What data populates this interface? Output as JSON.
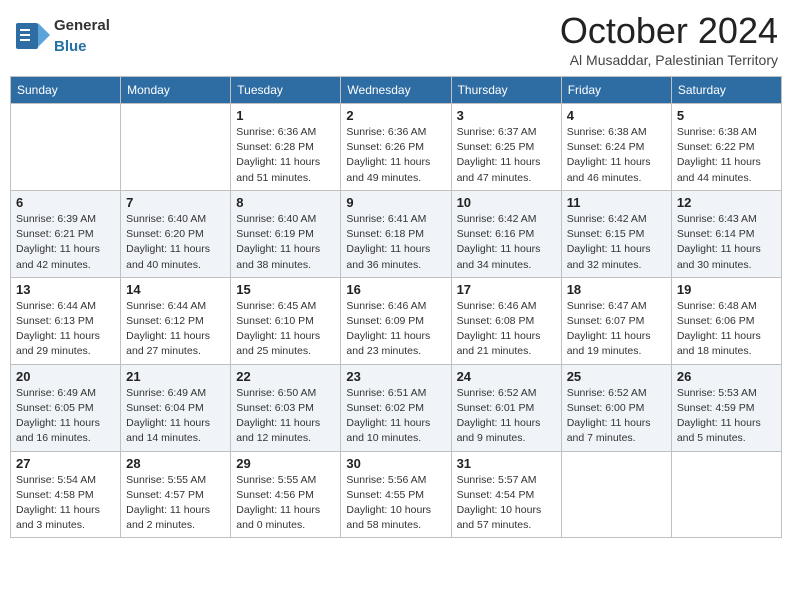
{
  "logo": {
    "text_general": "General",
    "text_blue": "Blue"
  },
  "header": {
    "month_title": "October 2024",
    "subtitle": "Al Musaddar, Palestinian Territory"
  },
  "weekdays": [
    "Sunday",
    "Monday",
    "Tuesday",
    "Wednesday",
    "Thursday",
    "Friday",
    "Saturday"
  ],
  "weeks": [
    [
      {
        "day": "",
        "info": ""
      },
      {
        "day": "",
        "info": ""
      },
      {
        "day": "1",
        "info": "Sunrise: 6:36 AM\nSunset: 6:28 PM\nDaylight: 11 hours and 51 minutes."
      },
      {
        "day": "2",
        "info": "Sunrise: 6:36 AM\nSunset: 6:26 PM\nDaylight: 11 hours and 49 minutes."
      },
      {
        "day": "3",
        "info": "Sunrise: 6:37 AM\nSunset: 6:25 PM\nDaylight: 11 hours and 47 minutes."
      },
      {
        "day": "4",
        "info": "Sunrise: 6:38 AM\nSunset: 6:24 PM\nDaylight: 11 hours and 46 minutes."
      },
      {
        "day": "5",
        "info": "Sunrise: 6:38 AM\nSunset: 6:22 PM\nDaylight: 11 hours and 44 minutes."
      }
    ],
    [
      {
        "day": "6",
        "info": "Sunrise: 6:39 AM\nSunset: 6:21 PM\nDaylight: 11 hours and 42 minutes."
      },
      {
        "day": "7",
        "info": "Sunrise: 6:40 AM\nSunset: 6:20 PM\nDaylight: 11 hours and 40 minutes."
      },
      {
        "day": "8",
        "info": "Sunrise: 6:40 AM\nSunset: 6:19 PM\nDaylight: 11 hours and 38 minutes."
      },
      {
        "day": "9",
        "info": "Sunrise: 6:41 AM\nSunset: 6:18 PM\nDaylight: 11 hours and 36 minutes."
      },
      {
        "day": "10",
        "info": "Sunrise: 6:42 AM\nSunset: 6:16 PM\nDaylight: 11 hours and 34 minutes."
      },
      {
        "day": "11",
        "info": "Sunrise: 6:42 AM\nSunset: 6:15 PM\nDaylight: 11 hours and 32 minutes."
      },
      {
        "day": "12",
        "info": "Sunrise: 6:43 AM\nSunset: 6:14 PM\nDaylight: 11 hours and 30 minutes."
      }
    ],
    [
      {
        "day": "13",
        "info": "Sunrise: 6:44 AM\nSunset: 6:13 PM\nDaylight: 11 hours and 29 minutes."
      },
      {
        "day": "14",
        "info": "Sunrise: 6:44 AM\nSunset: 6:12 PM\nDaylight: 11 hours and 27 minutes."
      },
      {
        "day": "15",
        "info": "Sunrise: 6:45 AM\nSunset: 6:10 PM\nDaylight: 11 hours and 25 minutes."
      },
      {
        "day": "16",
        "info": "Sunrise: 6:46 AM\nSunset: 6:09 PM\nDaylight: 11 hours and 23 minutes."
      },
      {
        "day": "17",
        "info": "Sunrise: 6:46 AM\nSunset: 6:08 PM\nDaylight: 11 hours and 21 minutes."
      },
      {
        "day": "18",
        "info": "Sunrise: 6:47 AM\nSunset: 6:07 PM\nDaylight: 11 hours and 19 minutes."
      },
      {
        "day": "19",
        "info": "Sunrise: 6:48 AM\nSunset: 6:06 PM\nDaylight: 11 hours and 18 minutes."
      }
    ],
    [
      {
        "day": "20",
        "info": "Sunrise: 6:49 AM\nSunset: 6:05 PM\nDaylight: 11 hours and 16 minutes."
      },
      {
        "day": "21",
        "info": "Sunrise: 6:49 AM\nSunset: 6:04 PM\nDaylight: 11 hours and 14 minutes."
      },
      {
        "day": "22",
        "info": "Sunrise: 6:50 AM\nSunset: 6:03 PM\nDaylight: 11 hours and 12 minutes."
      },
      {
        "day": "23",
        "info": "Sunrise: 6:51 AM\nSunset: 6:02 PM\nDaylight: 11 hours and 10 minutes."
      },
      {
        "day": "24",
        "info": "Sunrise: 6:52 AM\nSunset: 6:01 PM\nDaylight: 11 hours and 9 minutes."
      },
      {
        "day": "25",
        "info": "Sunrise: 6:52 AM\nSunset: 6:00 PM\nDaylight: 11 hours and 7 minutes."
      },
      {
        "day": "26",
        "info": "Sunrise: 5:53 AM\nSunset: 4:59 PM\nDaylight: 11 hours and 5 minutes."
      }
    ],
    [
      {
        "day": "27",
        "info": "Sunrise: 5:54 AM\nSunset: 4:58 PM\nDaylight: 11 hours and 3 minutes."
      },
      {
        "day": "28",
        "info": "Sunrise: 5:55 AM\nSunset: 4:57 PM\nDaylight: 11 hours and 2 minutes."
      },
      {
        "day": "29",
        "info": "Sunrise: 5:55 AM\nSunset: 4:56 PM\nDaylight: 11 hours and 0 minutes."
      },
      {
        "day": "30",
        "info": "Sunrise: 5:56 AM\nSunset: 4:55 PM\nDaylight: 10 hours and 58 minutes."
      },
      {
        "day": "31",
        "info": "Sunrise: 5:57 AM\nSunset: 4:54 PM\nDaylight: 10 hours and 57 minutes."
      },
      {
        "day": "",
        "info": ""
      },
      {
        "day": "",
        "info": ""
      }
    ]
  ]
}
